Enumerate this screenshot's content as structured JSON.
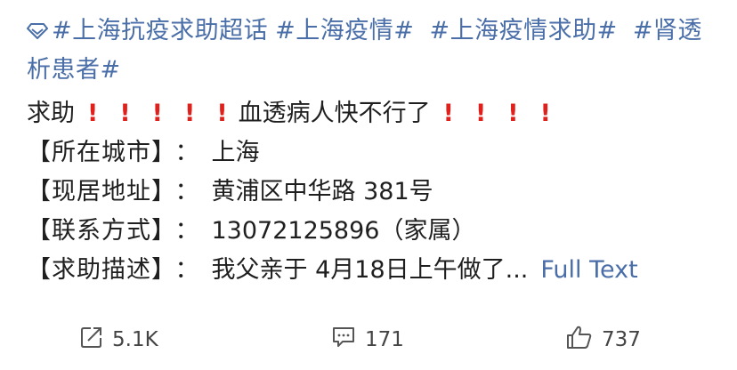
{
  "post": {
    "hashtags": [
      "#上海抗疫求助超话",
      "#上海疫情#",
      "#上海疫情求助#",
      "#肾透析患者#"
    ],
    "help_prefix": "求助",
    "help_text": "血透病人快不行了",
    "bang": "!",
    "fields": [
      {
        "label": "【所在城市】",
        "value": "上海"
      },
      {
        "label": "【现居地址】",
        "value": "黄浦区中华路 381号"
      },
      {
        "label": "【联系方式】",
        "value": "13072125896（家属）"
      },
      {
        "label": "【求助描述】",
        "value": "我父亲于 4月18日上午做了..."
      }
    ],
    "separator": "：",
    "full_text_label": "Full Text"
  },
  "actions": {
    "repost_count": "5.1K",
    "comment_count": "171",
    "like_count": "737"
  },
  "colors": {
    "link": "#4a6ea8",
    "alert": "#e0201a",
    "text": "#1f1f1f"
  },
  "icons": {
    "supertopic": "diamond-icon",
    "repost": "repost-icon",
    "comment": "comment-icon",
    "like": "thumbs-up-icon"
  }
}
